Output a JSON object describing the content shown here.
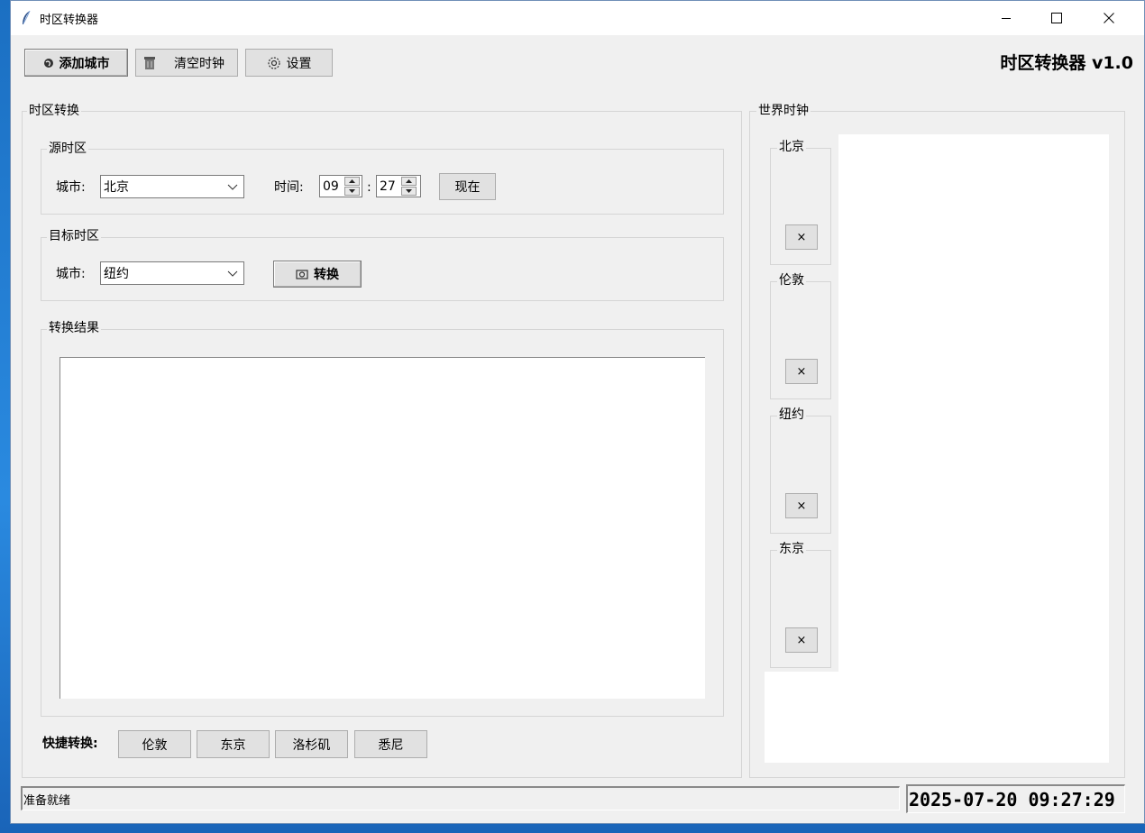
{
  "window": {
    "title": "时区转换器"
  },
  "toolbar": {
    "add_city": "添加城市",
    "clear_clocks": "清空时钟",
    "settings": "设置",
    "app_heading": "时区转换器 v1.0"
  },
  "converter": {
    "group_title": "时区转换",
    "source": {
      "group_title": "源时区",
      "city_label": "城市:",
      "city_value": "北京",
      "time_label": "时间:",
      "hour": "09",
      "separator": ":",
      "minute": "27",
      "now_button": "现在"
    },
    "target": {
      "group_title": "目标时区",
      "city_label": "城市:",
      "city_value": "纽约",
      "convert_button": "转换"
    },
    "result": {
      "group_title": "转换结果",
      "text": ""
    },
    "quick": {
      "label": "快捷转换:",
      "buttons": [
        "伦敦",
        "东京",
        "洛杉矶",
        "悉尼"
      ]
    }
  },
  "world_clock": {
    "group_title": "世界时钟",
    "clocks": [
      {
        "city": "北京",
        "remove": "×"
      },
      {
        "city": "伦敦",
        "remove": "×"
      },
      {
        "city": "纽约",
        "remove": "×"
      },
      {
        "city": "东京",
        "remove": "×"
      }
    ]
  },
  "statusbar": {
    "status": "准备就绪",
    "datetime": "2025-07-20 09:27:29"
  }
}
